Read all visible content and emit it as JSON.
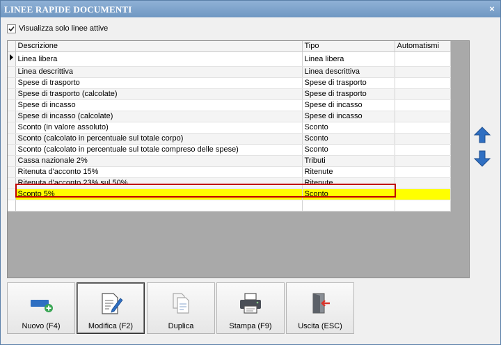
{
  "window": {
    "title": "LINEE RAPIDE DOCUMENTI",
    "close_glyph": "×"
  },
  "filter": {
    "label": "Visualizza solo linee attive",
    "checked": true
  },
  "grid": {
    "columns": [
      "Descrizione",
      "Tipo",
      "Automatismi"
    ],
    "rows": [
      {
        "descrizione": "Linea libera",
        "tipo": "Linea libera",
        "automatismi": ""
      },
      {
        "descrizione": "Linea descrittiva",
        "tipo": "Linea descrittiva",
        "automatismi": ""
      },
      {
        "descrizione": "Spese di trasporto",
        "tipo": "Spese di trasporto",
        "automatismi": ""
      },
      {
        "descrizione": "Spese di trasporto (calcolate)",
        "tipo": "Spese di trasporto",
        "automatismi": ""
      },
      {
        "descrizione": "Spese di incasso",
        "tipo": "Spese di incasso",
        "automatismi": ""
      },
      {
        "descrizione": "Spese di incasso (calcolate)",
        "tipo": "Spese di incasso",
        "automatismi": ""
      },
      {
        "descrizione": "Sconto (in valore assoluto)",
        "tipo": "Sconto",
        "automatismi": ""
      },
      {
        "descrizione": "Sconto (calcolato in percentuale sul totale corpo)",
        "tipo": "Sconto",
        "automatismi": ""
      },
      {
        "descrizione": "Sconto (calcolato in percentuale sul totale compreso delle spese)",
        "tipo": "Sconto",
        "automatismi": ""
      },
      {
        "descrizione": "Cassa nazionale 2%",
        "tipo": "Tributi",
        "automatismi": ""
      },
      {
        "descrizione": "Ritenuta d'acconto 15%",
        "tipo": "Ritenute",
        "automatismi": ""
      },
      {
        "descrizione": "Ritenuta d'acconto 23% sul 50%",
        "tipo": "Ritenute",
        "automatismi": ""
      },
      {
        "descrizione": "Sconto 5%",
        "tipo": "Sconto",
        "automatismi": "",
        "selected": true
      }
    ],
    "current_row_indicator": "arrow-right-icon",
    "highlight_color": "#ffff00",
    "outline_color": "#c00000"
  },
  "side_buttons": [
    {
      "name": "move-up-button",
      "icon": "arrow-up-icon"
    },
    {
      "name": "move-down-button",
      "icon": "arrow-down-icon"
    }
  ],
  "toolbar": {
    "buttons": [
      {
        "name": "nuovo-button",
        "label": "Nuovo (F4)",
        "icon": "add-line-icon"
      },
      {
        "name": "modifica-button",
        "label": "Modifica (F2)",
        "icon": "edit-document-icon",
        "active": true
      },
      {
        "name": "duplica-button",
        "label": "Duplica",
        "icon": "duplicate-icon"
      },
      {
        "name": "stampa-button",
        "label": "Stampa (F9)",
        "icon": "printer-icon"
      },
      {
        "name": "uscita-button",
        "label": "Uscita (ESC)",
        "icon": "exit-door-icon"
      }
    ]
  },
  "colors": {
    "titlebar": "#7aa0c8",
    "accent_blue": "#2f6fc2"
  }
}
